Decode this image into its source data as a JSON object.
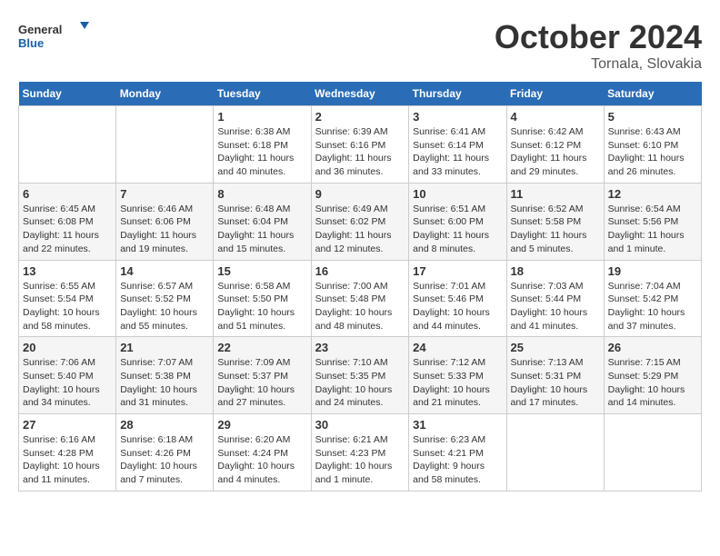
{
  "header": {
    "logo_general": "General",
    "logo_blue": "Blue",
    "month_title": "October 2024",
    "location": "Tornala, Slovakia"
  },
  "weekdays": [
    "Sunday",
    "Monday",
    "Tuesday",
    "Wednesday",
    "Thursday",
    "Friday",
    "Saturday"
  ],
  "weeks": [
    [
      null,
      null,
      {
        "day": 1,
        "sunrise": "6:38 AM",
        "sunset": "6:18 PM",
        "daylight": "11 hours and 40 minutes."
      },
      {
        "day": 2,
        "sunrise": "6:39 AM",
        "sunset": "6:16 PM",
        "daylight": "11 hours and 36 minutes."
      },
      {
        "day": 3,
        "sunrise": "6:41 AM",
        "sunset": "6:14 PM",
        "daylight": "11 hours and 33 minutes."
      },
      {
        "day": 4,
        "sunrise": "6:42 AM",
        "sunset": "6:12 PM",
        "daylight": "11 hours and 29 minutes."
      },
      {
        "day": 5,
        "sunrise": "6:43 AM",
        "sunset": "6:10 PM",
        "daylight": "11 hours and 26 minutes."
      }
    ],
    [
      {
        "day": 6,
        "sunrise": "6:45 AM",
        "sunset": "6:08 PM",
        "daylight": "11 hours and 22 minutes."
      },
      {
        "day": 7,
        "sunrise": "6:46 AM",
        "sunset": "6:06 PM",
        "daylight": "11 hours and 19 minutes."
      },
      {
        "day": 8,
        "sunrise": "6:48 AM",
        "sunset": "6:04 PM",
        "daylight": "11 hours and 15 minutes."
      },
      {
        "day": 9,
        "sunrise": "6:49 AM",
        "sunset": "6:02 PM",
        "daylight": "11 hours and 12 minutes."
      },
      {
        "day": 10,
        "sunrise": "6:51 AM",
        "sunset": "6:00 PM",
        "daylight": "11 hours and 8 minutes."
      },
      {
        "day": 11,
        "sunrise": "6:52 AM",
        "sunset": "5:58 PM",
        "daylight": "11 hours and 5 minutes."
      },
      {
        "day": 12,
        "sunrise": "6:54 AM",
        "sunset": "5:56 PM",
        "daylight": "11 hours and 1 minute."
      }
    ],
    [
      {
        "day": 13,
        "sunrise": "6:55 AM",
        "sunset": "5:54 PM",
        "daylight": "10 hours and 58 minutes."
      },
      {
        "day": 14,
        "sunrise": "6:57 AM",
        "sunset": "5:52 PM",
        "daylight": "10 hours and 55 minutes."
      },
      {
        "day": 15,
        "sunrise": "6:58 AM",
        "sunset": "5:50 PM",
        "daylight": "10 hours and 51 minutes."
      },
      {
        "day": 16,
        "sunrise": "7:00 AM",
        "sunset": "5:48 PM",
        "daylight": "10 hours and 48 minutes."
      },
      {
        "day": 17,
        "sunrise": "7:01 AM",
        "sunset": "5:46 PM",
        "daylight": "10 hours and 44 minutes."
      },
      {
        "day": 18,
        "sunrise": "7:03 AM",
        "sunset": "5:44 PM",
        "daylight": "10 hours and 41 minutes."
      },
      {
        "day": 19,
        "sunrise": "7:04 AM",
        "sunset": "5:42 PM",
        "daylight": "10 hours and 37 minutes."
      }
    ],
    [
      {
        "day": 20,
        "sunrise": "7:06 AM",
        "sunset": "5:40 PM",
        "daylight": "10 hours and 34 minutes."
      },
      {
        "day": 21,
        "sunrise": "7:07 AM",
        "sunset": "5:38 PM",
        "daylight": "10 hours and 31 minutes."
      },
      {
        "day": 22,
        "sunrise": "7:09 AM",
        "sunset": "5:37 PM",
        "daylight": "10 hours and 27 minutes."
      },
      {
        "day": 23,
        "sunrise": "7:10 AM",
        "sunset": "5:35 PM",
        "daylight": "10 hours and 24 minutes."
      },
      {
        "day": 24,
        "sunrise": "7:12 AM",
        "sunset": "5:33 PM",
        "daylight": "10 hours and 21 minutes."
      },
      {
        "day": 25,
        "sunrise": "7:13 AM",
        "sunset": "5:31 PM",
        "daylight": "10 hours and 17 minutes."
      },
      {
        "day": 26,
        "sunrise": "7:15 AM",
        "sunset": "5:29 PM",
        "daylight": "10 hours and 14 minutes."
      }
    ],
    [
      {
        "day": 27,
        "sunrise": "6:16 AM",
        "sunset": "4:28 PM",
        "daylight": "10 hours and 11 minutes."
      },
      {
        "day": 28,
        "sunrise": "6:18 AM",
        "sunset": "4:26 PM",
        "daylight": "10 hours and 7 minutes."
      },
      {
        "day": 29,
        "sunrise": "6:20 AM",
        "sunset": "4:24 PM",
        "daylight": "10 hours and 4 minutes."
      },
      {
        "day": 30,
        "sunrise": "6:21 AM",
        "sunset": "4:23 PM",
        "daylight": "10 hours and 1 minute."
      },
      {
        "day": 31,
        "sunrise": "6:23 AM",
        "sunset": "4:21 PM",
        "daylight": "9 hours and 58 minutes."
      },
      null,
      null
    ]
  ]
}
